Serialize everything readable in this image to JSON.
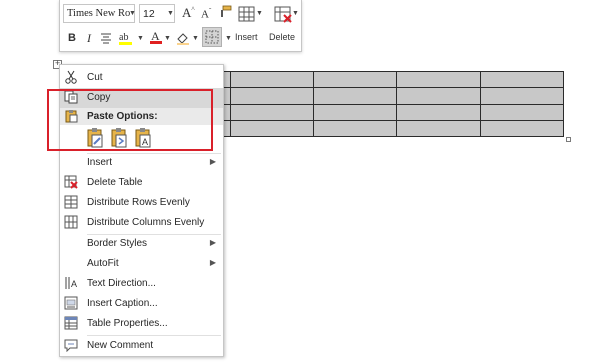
{
  "toolbar": {
    "font_name": "Times New Ro",
    "font_size": "12",
    "insert_label": "Insert",
    "delete_label": "Delete",
    "buttons": [
      "grow-font-icon",
      "shrink-font-icon",
      "format-painter-icon",
      "bold-icon",
      "italic-icon",
      "center-align-icon",
      "highlight-icon",
      "font-color-icon",
      "shading-icon",
      "borders-icon",
      "insert-table-icon",
      "delete-table-icon"
    ],
    "bold": "B",
    "italic": "I",
    "grow_glyph": "A",
    "shrink_glyph": "A",
    "font_color_glyph": "A"
  },
  "context_menu": {
    "items": [
      {
        "label": "Cut",
        "icon": "scissors-icon"
      },
      {
        "label": "Copy",
        "icon": "copy-icon"
      },
      {
        "label": "Paste Options:",
        "icon": "clipboard-icon"
      },
      {
        "label": "Insert",
        "icon": "",
        "submenu": true
      },
      {
        "label": "Delete Table",
        "icon": "delete-table-icon"
      },
      {
        "label": "Distribute Rows Evenly",
        "icon": "distribute-rows-icon"
      },
      {
        "label": "Distribute Columns Evenly",
        "icon": "distribute-columns-icon"
      },
      {
        "label": "Border Styles",
        "icon": "",
        "submenu": true
      },
      {
        "label": "AutoFit",
        "icon": "",
        "submenu": true
      },
      {
        "label": "Text Direction...",
        "icon": "text-direction-icon"
      },
      {
        "label": "Insert Caption...",
        "icon": "insert-caption-icon"
      },
      {
        "label": "Table Properties...",
        "icon": "table-properties-icon"
      },
      {
        "label": "New Comment",
        "icon": "comment-icon"
      }
    ],
    "paste_options": [
      "paste-keep-source-icon",
      "paste-merge-table-icon",
      "paste-keep-text-icon"
    ],
    "submenu_arrow": "▶"
  },
  "table": {
    "rows": 4,
    "columns": 5
  },
  "colors": {
    "highlight": "#d9202a",
    "selected_cell": "#c8c8c8",
    "hover_item": "#d8d8d8"
  }
}
